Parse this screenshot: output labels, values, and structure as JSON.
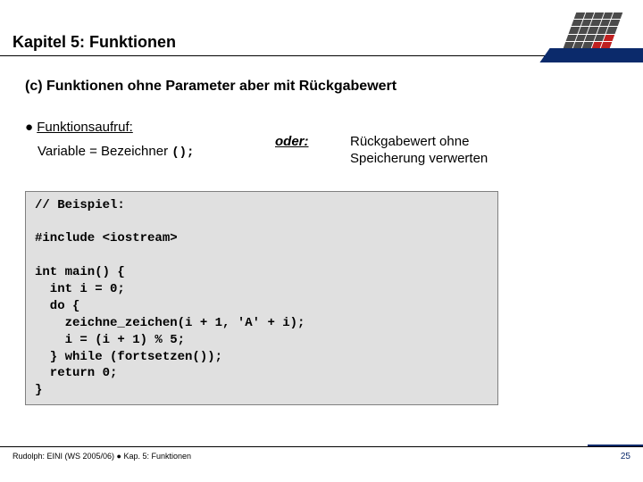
{
  "header": {
    "title": "Kapitel 5: Funktionen"
  },
  "subtitle": "(c) Funktionen ohne Parameter aber mit Rückgabewert",
  "bullet": {
    "label": "Funktionsaufruf:",
    "sub_prefix": "Variable = Bezeichner ",
    "sub_mono": "();",
    "oder": "oder:",
    "right_line1": "Rückgabewert ohne",
    "right_line2": "Speicherung verwerten"
  },
  "code": "// Beispiel:\n\n#include <iostream>\n\nint main() {\n  int i = 0;\n  do {\n    zeichne_zeichen(i + 1, 'A' + i);\n    i = (i + 1) % 5;\n  } while (fortsetzen());\n  return 0;\n}",
  "footer": {
    "text": "Rudolph: EINI (WS 2005/06)  ●  Kap. 5: Funktionen",
    "page": "25"
  }
}
